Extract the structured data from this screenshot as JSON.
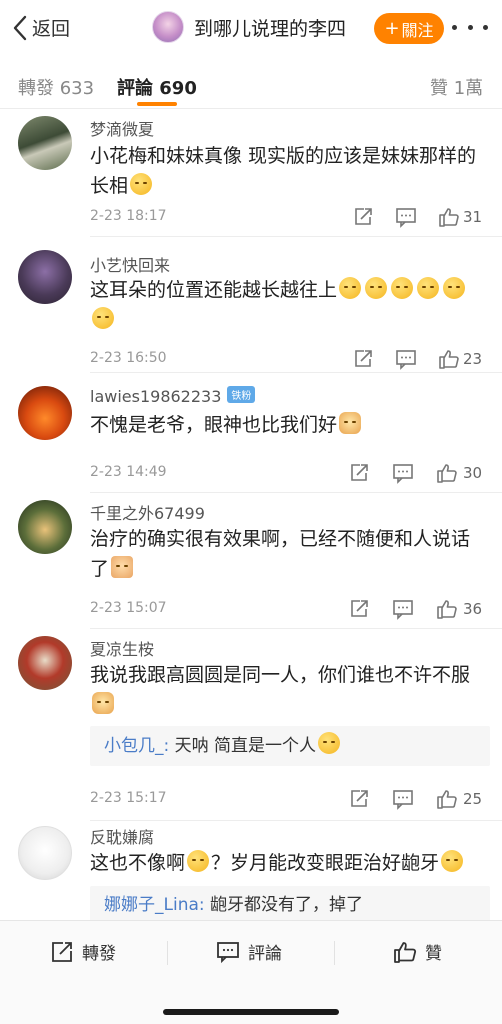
{
  "header": {
    "back_label": "返回",
    "title": "到哪儿说理的李四",
    "follow_label": "關注",
    "follow_plus": "+"
  },
  "tabs": {
    "repost": "轉發 633",
    "comment": "評論 690",
    "like": "贊 1萬"
  },
  "colors": {
    "accent": "#ff8200",
    "link": "#4a7cc7",
    "badge": "#5fa9e8"
  },
  "comments": [
    {
      "name": "梦滴微夏",
      "text": "小花梅和妹妹真像 现实版的应该是妹妹那样的长相",
      "emoji": "laugh-cry-emoji",
      "time": "2-23 18:17",
      "likes": "31"
    },
    {
      "name": "小艺快回来",
      "text": "这耳朵的位置还能越长越往上",
      "emoji": "sweat-smile-emoji",
      "time": "2-23 16:50",
      "likes": "23"
    },
    {
      "name": "lawies19862233",
      "badge": "铁粉",
      "text": "不愧是老爷，眼神也比我们好",
      "emoji": "cat-emoji",
      "time": "2-23 14:49",
      "likes": "30"
    },
    {
      "name": "千里之外67499",
      "text": "治疗的确实很有效果啊，已经不随便和人说话了",
      "emoji": "thumbs-up-emoji",
      "time": "2-23 15:07",
      "likes": "36"
    },
    {
      "name": "夏凉生桉",
      "text": "我说我跟高圆圆是同一人，你们谁也不许不服",
      "emoji": "cat-emoji",
      "reply_user": "小包几_",
      "reply_text": "天呐  简直是一个人",
      "time": "2-23 15:17",
      "likes": "25"
    },
    {
      "name": "反耽嫌腐",
      "text_a": "这也不像啊",
      "text_b": "？岁月能改变眼距治好龅牙",
      "reply_user": "娜娜子_Lina",
      "reply_text": "龅牙都没有了，掉了"
    }
  ],
  "bottom_bar": {
    "repost": "轉發",
    "comment": "評論",
    "like": "贊"
  },
  "icons": [
    "chevron-left-icon",
    "more-dots-icon",
    "share-icon",
    "comment-icon",
    "like-icon"
  ]
}
